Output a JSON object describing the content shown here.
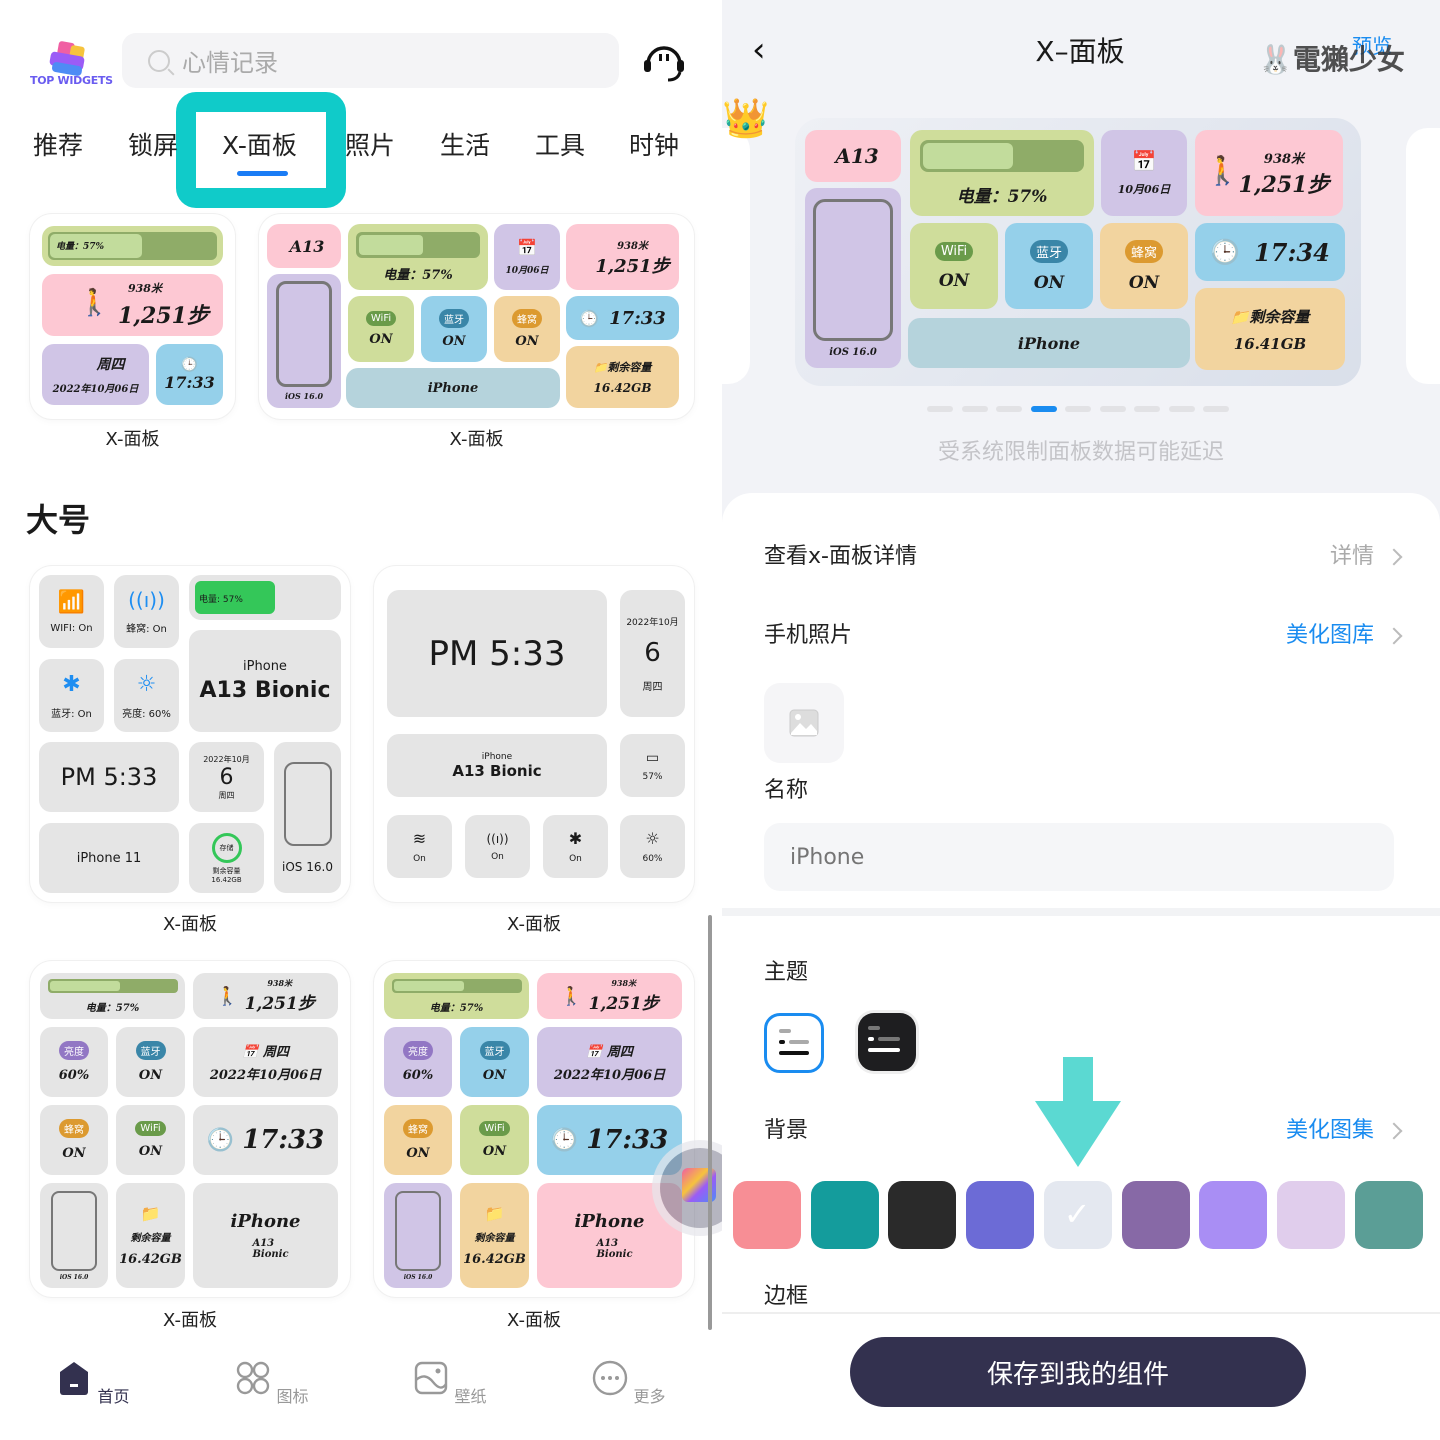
{
  "left": {
    "logo_text": "TOP WIDGETS",
    "search": {
      "placeholder": "心情记录"
    },
    "tabs": [
      "推荐",
      "锁屏",
      "X-面板",
      "照片",
      "生活",
      "工具",
      "时钟"
    ],
    "active_tab": "X-面板",
    "highlight_color": "#10cbc9",
    "accent_color": "#1a7cf5",
    "section_large": "大号",
    "widget_caption": "X-面板",
    "small_widget_1": {
      "battery": "电量：57%",
      "steps_distance": "938米",
      "steps": "1,251步",
      "weekday": "周四",
      "date": "2022年10月06日",
      "time": "17:33"
    },
    "small_widget_2": {
      "chip": "A13",
      "battery": "电量：57%",
      "date": "10月06日",
      "steps_distance": "938米",
      "steps": "1,251步",
      "wifi_label": "WiFi",
      "wifi": "ON",
      "bt_label": "蓝牙",
      "bt": "ON",
      "cell_label": "蜂窝",
      "cell": "ON",
      "time": "17:33",
      "storage_label": "剩余容量",
      "storage": "16.42GB",
      "device": "iPhone",
      "os": "iOS 16.0"
    },
    "large_widget_1": {
      "wifi": "WIFI: On",
      "cell": "蜂窝: On",
      "battery": "电量: 57%",
      "bt": "蓝牙: On",
      "brightness": "亮度: 60%",
      "device": "iPhone",
      "chip": "A13 Bionic",
      "time": "PM 5:33",
      "month": "2022年10月",
      "day": "6",
      "weekday": "周四",
      "model": "iPhone 11",
      "storage_ring": "存储",
      "storage_label": "剩余容量",
      "storage": "16.42GB",
      "os": "iOS 16.0"
    },
    "large_widget_2": {
      "time": "PM 5:33",
      "month": "2022年10月",
      "day": "6",
      "weekday": "周四",
      "device": "iPhone",
      "chip": "A13 Bionic",
      "battery": "57%",
      "wifi": "On",
      "cell": "On",
      "bt": "On",
      "brightness": "60%"
    },
    "large_widget_3": {
      "battery": "电量：57%",
      "steps_distance": "938米",
      "steps": "1,251步",
      "brightness_label": "亮度",
      "brightness": "60%",
      "bt_label": "蓝牙",
      "bt": "ON",
      "weekday": "周四",
      "date": "2022年10月06日",
      "cell_label": "蜂窝",
      "cell": "ON",
      "wifi_label": "WiFi",
      "wifi": "ON",
      "time": "17:33",
      "storage_label": "剩余容量",
      "storage": "16.42GB",
      "device": "iPhone",
      "chip": "A13",
      "chip2": "Bionic",
      "os": "iOS 16.0"
    },
    "large_widget_4": {
      "battery": "电量：57%",
      "steps_distance": "938米",
      "steps": "1,251步",
      "brightness_label": "亮度",
      "brightness": "60%",
      "bt_label": "蓝牙",
      "bt": "ON",
      "weekday": "周四",
      "date": "2022年10月06日",
      "cell_label": "蜂窝",
      "cell": "ON",
      "wifi_label": "WiFi",
      "wifi": "ON",
      "time": "17:33",
      "storage_label": "剩余容量",
      "storage": "16.42GB",
      "device": "iPhone",
      "chip": "A13",
      "chip2": "Bionic",
      "os": "iOS 16.0"
    },
    "bottom_nav": [
      {
        "label": "首页",
        "icon": "home-icon",
        "active": true
      },
      {
        "label": "图标",
        "icon": "grid-icon",
        "active": false
      },
      {
        "label": "壁纸",
        "icon": "wallpaper-icon",
        "active": false
      },
      {
        "label": "更多",
        "icon": "more-icon",
        "active": false
      }
    ],
    "battery_percent": 57
  },
  "right": {
    "title": "X–面板",
    "preview_label": "预览",
    "watermark": "電獺少女",
    "preview": {
      "chip": "A13",
      "battery": "电量：57%",
      "date": "10月06日",
      "steps_distance": "938米",
      "steps": "1,251步",
      "wifi_label": "WiFi",
      "wifi": "ON",
      "bt_label": "蓝牙",
      "bt": "ON",
      "cell_label": "蜂窝",
      "cell": "ON",
      "time": "17:34",
      "storage_label": "剩余容量",
      "storage": "16.41GB",
      "device": "iPhone",
      "os": "iOS 16.0"
    },
    "page_dots": 9,
    "active_dot": 4,
    "notice": "受系统限制面板数据可能延迟",
    "details_row": {
      "label": "查看x-面板详情",
      "value": "详情"
    },
    "photo_row": {
      "label": "手机照片",
      "value": "美化图库"
    },
    "name_label": "名称",
    "name_input": {
      "placeholder": "iPhone"
    },
    "theme_label": "主题",
    "background_row": {
      "label": "背景",
      "value": "美化图集"
    },
    "border_label": "边框",
    "swatches": [
      "#f78e95",
      "#149c9c",
      "#2a2a2a",
      "#6c6bd6",
      "#e4e8f0",
      "#8769a6",
      "#a98ef4",
      "#e0cdec",
      "#5b9e96"
    ],
    "selected_swatch": 4,
    "save_button": "保存到我的组件",
    "link_color": "#1a8cf0",
    "arrow_color": "#5bd9d2"
  }
}
